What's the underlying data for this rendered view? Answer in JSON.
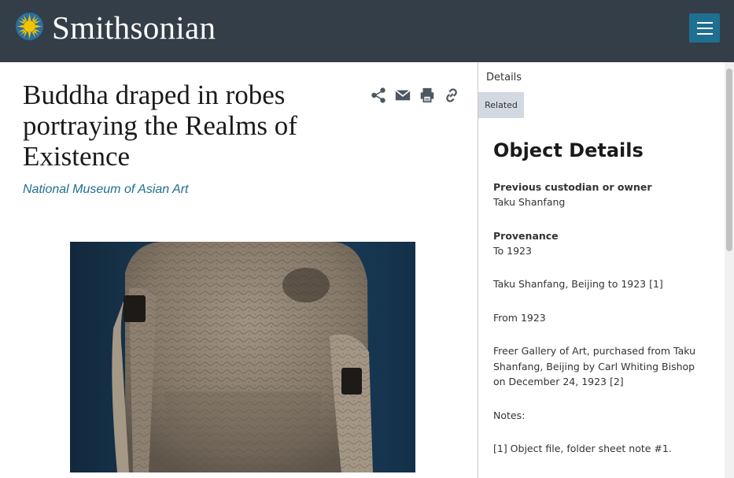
{
  "header": {
    "logo_text": "Smithsonian",
    "logo_icon": "sun-icon",
    "menu_icon": "hamburger-menu-icon"
  },
  "object": {
    "title": "Buddha draped in robes portraying the Realms of Existence",
    "unit": "National Museum of Asian Art"
  },
  "tools": [
    "share-icon",
    "email-icon",
    "print-icon",
    "link-icon"
  ],
  "side": {
    "tabs": {
      "details": "Details",
      "related": "Related"
    },
    "heading": "Object Details",
    "fields": {
      "custodian_label": "Previous custodian or owner",
      "custodian_value": "Taku Shanfang",
      "provenance_label": "Provenance",
      "provenance_lines": [
        "To 1923",
        "Taku Shanfang, Beijing to 1923 [1]",
        "From 1923",
        "Freer Gallery of Art, purchased from Taku Shanfang, Beijing by Carl Whiting Bishop on December 24, 1923 [2]",
        "Notes:",
        "[1] Object file, folder sheet note #1."
      ]
    }
  },
  "colors": {
    "header_bg": "#333e48",
    "accent": "#1f6f91",
    "related_tab_bg": "#d3d9e0"
  }
}
